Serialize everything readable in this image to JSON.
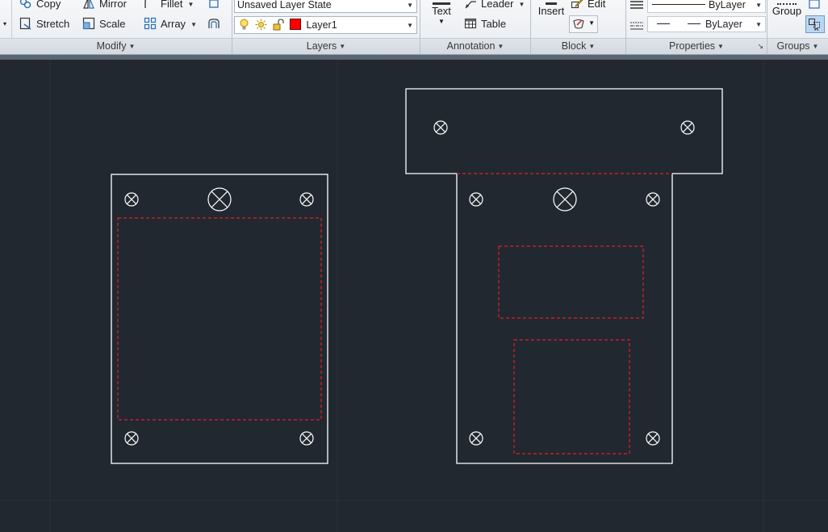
{
  "ribbon": {
    "modify": {
      "title": "Modify",
      "copy": "Copy",
      "mirror": "Mirror",
      "fillet": "Fillet",
      "stretch": "Stretch",
      "scale": "Scale",
      "array": "Array"
    },
    "layers": {
      "title": "Layers",
      "layer_state": "Unsaved Layer State",
      "current_layer": "Layer1",
      "layer_color": "#ff0000"
    },
    "annotation": {
      "title": "Annotation",
      "text": "Text",
      "leader": "Leader",
      "table": "Table"
    },
    "block": {
      "title": "Block",
      "insert": "Insert",
      "edit": "Edit"
    },
    "properties": {
      "title": "Properties",
      "lineweight": "ByLayer",
      "linetype": "ByLayer"
    },
    "groups": {
      "title": "Groups",
      "group": "Group"
    }
  },
  "colors": {
    "canvas_background": "#212830",
    "outline": "#ffffff",
    "hidden_line": "#e02020"
  }
}
